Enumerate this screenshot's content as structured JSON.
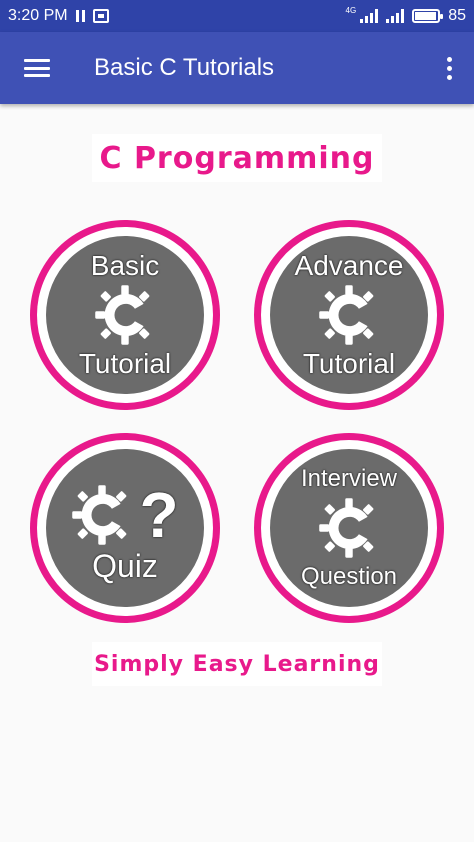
{
  "status_bar": {
    "time": "3:20 PM",
    "network_label": "4G",
    "battery_level": "85"
  },
  "app_bar": {
    "title": "Basic C Tutorials"
  },
  "banners": {
    "top": "C Programming",
    "bottom": "Simply Easy Learning"
  },
  "tiles": [
    {
      "line_top": "Basic",
      "line_bottom": "Tutorial"
    },
    {
      "line_top": "Advance",
      "line_bottom": "Tutorial"
    },
    {
      "symbol": "?",
      "line_bottom": "Quiz"
    },
    {
      "line_top": "Interview",
      "line_bottom": "Question"
    }
  ],
  "colors": {
    "status_bar": "#2f43a8",
    "app_bar": "#3f51b5",
    "accent_pink": "#e8198b",
    "tile_core": "#6b6b6b"
  },
  "icons": {
    "menu": "hamburger-icon",
    "overflow": "more-vertical-icon",
    "tile_symbol": "gear-c-icon"
  }
}
